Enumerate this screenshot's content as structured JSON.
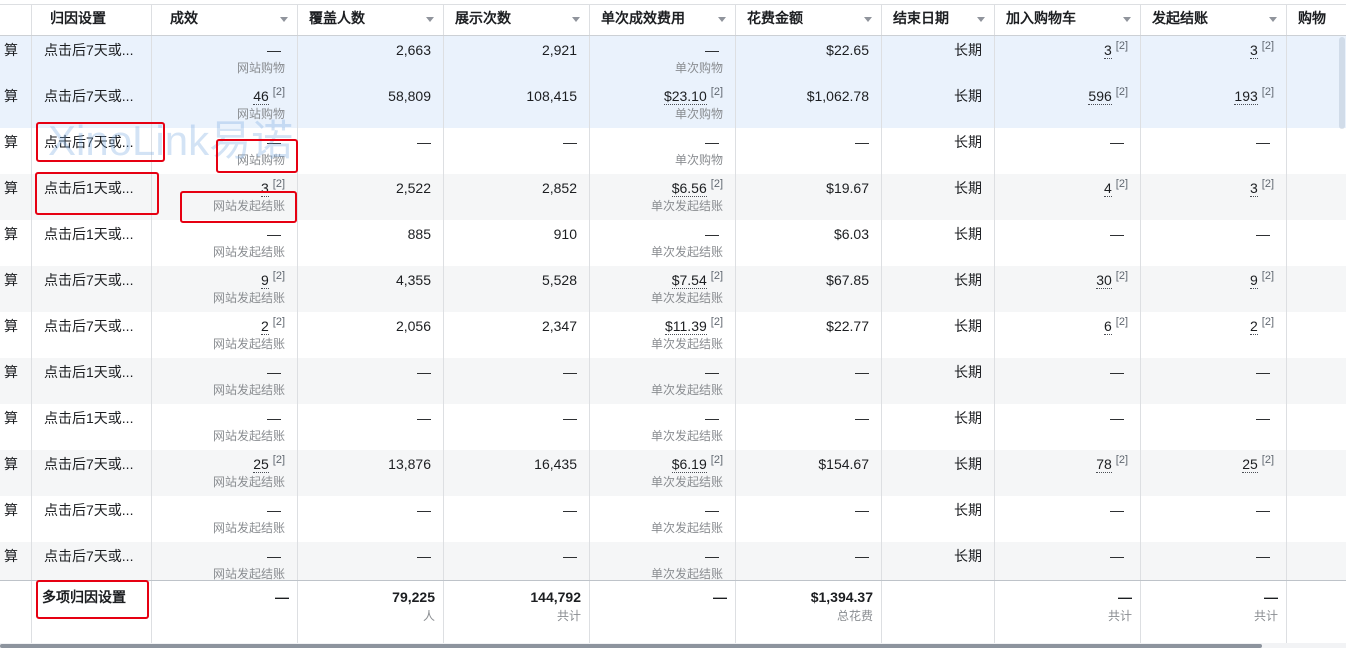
{
  "columns": {
    "attribution": "归因设置",
    "results": "成效",
    "reach": "覆盖人数",
    "impressions": "展示次数",
    "cost_per_result": "单次成效费用",
    "amount_spent": "花费金额",
    "end_date": "结束日期",
    "add_to_cart": "加入购物车",
    "checkouts": "发起结账",
    "purchases": "购物"
  },
  "icons": {
    "column_menu": "chevron-down-icon"
  },
  "colors": {
    "selected_row": "#eaf2fc",
    "striped_row": "#f5f6f7",
    "annotation": "#e60012"
  },
  "watermark": "XinoLink易诺",
  "rows": [
    {
      "highlighted": true,
      "lead": "算",
      "attribution": "点击后7天或...",
      "results": {
        "value": "—",
        "note": "",
        "sub": "网站购物"
      },
      "reach": "2,663",
      "impressions": "2,921",
      "cost_per_result": {
        "value": "—",
        "note": "",
        "sub": "单次购物"
      },
      "amount_spent": "$22.65",
      "end_date": "长期",
      "add_to_cart": {
        "value": "3",
        "note": "[2]"
      },
      "checkouts": {
        "value": "3",
        "note": "[2]"
      }
    },
    {
      "highlighted": true,
      "lead": "算",
      "attribution": "点击后7天或...",
      "results": {
        "value": "46",
        "note": "[2]",
        "sub": "网站购物"
      },
      "reach": "58,809",
      "impressions": "108,415",
      "cost_per_result": {
        "value": "$23.10",
        "note": "[2]",
        "sub": "单次购物"
      },
      "amount_spent": "$1,062.78",
      "end_date": "长期",
      "add_to_cart": {
        "value": "596",
        "note": "[2]"
      },
      "checkouts": {
        "value": "193",
        "note": "[2]"
      }
    },
    {
      "lead": "算",
      "attribution": "点击后7天或...",
      "results": {
        "value": "—",
        "note": "",
        "sub": "网站购物"
      },
      "reach": "—",
      "impressions": "—",
      "cost_per_result": {
        "value": "—",
        "note": "",
        "sub": "单次购物"
      },
      "amount_spent": "—",
      "end_date": "长期",
      "add_to_cart": {
        "value": "—",
        "note": ""
      },
      "checkouts": {
        "value": "—",
        "note": ""
      }
    },
    {
      "lead": "算",
      "attribution": "点击后1天或...",
      "results": {
        "value": "3",
        "note": "[2]",
        "sub": "网站发起结账"
      },
      "reach": "2,522",
      "impressions": "2,852",
      "cost_per_result": {
        "value": "$6.56",
        "note": "[2]",
        "sub": "单次发起结账"
      },
      "amount_spent": "$19.67",
      "end_date": "长期",
      "add_to_cart": {
        "value": "4",
        "note": "[2]"
      },
      "checkouts": {
        "value": "3",
        "note": "[2]"
      }
    },
    {
      "lead": "算",
      "attribution": "点击后1天或...",
      "results": {
        "value": "—",
        "note": "",
        "sub": "网站发起结账"
      },
      "reach": "885",
      "impressions": "910",
      "cost_per_result": {
        "value": "—",
        "note": "",
        "sub": "单次发起结账"
      },
      "amount_spent": "$6.03",
      "end_date": "长期",
      "add_to_cart": {
        "value": "—",
        "note": ""
      },
      "checkouts": {
        "value": "—",
        "note": ""
      }
    },
    {
      "lead": "算",
      "attribution": "点击后7天或...",
      "results": {
        "value": "9",
        "note": "[2]",
        "sub": "网站发起结账"
      },
      "reach": "4,355",
      "impressions": "5,528",
      "cost_per_result": {
        "value": "$7.54",
        "note": "[2]",
        "sub": "单次发起结账"
      },
      "amount_spent": "$67.85",
      "end_date": "长期",
      "add_to_cart": {
        "value": "30",
        "note": "[2]"
      },
      "checkouts": {
        "value": "9",
        "note": "[2]"
      }
    },
    {
      "lead": "算",
      "attribution": "点击后7天或...",
      "results": {
        "value": "2",
        "note": "[2]",
        "sub": "网站发起结账"
      },
      "reach": "2,056",
      "impressions": "2,347",
      "cost_per_result": {
        "value": "$11.39",
        "note": "[2]",
        "sub": "单次发起结账"
      },
      "amount_spent": "$22.77",
      "end_date": "长期",
      "add_to_cart": {
        "value": "6",
        "note": "[2]"
      },
      "checkouts": {
        "value": "2",
        "note": "[2]"
      }
    },
    {
      "lead": "算",
      "attribution": "点击后1天或...",
      "results": {
        "value": "—",
        "note": "",
        "sub": "网站发起结账"
      },
      "reach": "—",
      "impressions": "—",
      "cost_per_result": {
        "value": "—",
        "note": "",
        "sub": "单次发起结账"
      },
      "amount_spent": "—",
      "end_date": "长期",
      "add_to_cart": {
        "value": "—",
        "note": ""
      },
      "checkouts": {
        "value": "—",
        "note": ""
      }
    },
    {
      "lead": "算",
      "attribution": "点击后1天或...",
      "results": {
        "value": "—",
        "note": "",
        "sub": "网站发起结账"
      },
      "reach": "—",
      "impressions": "—",
      "cost_per_result": {
        "value": "—",
        "note": "",
        "sub": "单次发起结账"
      },
      "amount_spent": "—",
      "end_date": "长期",
      "add_to_cart": {
        "value": "—",
        "note": ""
      },
      "checkouts": {
        "value": "—",
        "note": ""
      }
    },
    {
      "lead": "算",
      "attribution": "点击后7天或...",
      "results": {
        "value": "25",
        "note": "[2]",
        "sub": "网站发起结账"
      },
      "reach": "13,876",
      "impressions": "16,435",
      "cost_per_result": {
        "value": "$6.19",
        "note": "[2]",
        "sub": "单次发起结账"
      },
      "amount_spent": "$154.67",
      "end_date": "长期",
      "add_to_cart": {
        "value": "78",
        "note": "[2]"
      },
      "checkouts": {
        "value": "25",
        "note": "[2]"
      }
    },
    {
      "lead": "算",
      "attribution": "点击后7天或...",
      "results": {
        "value": "—",
        "note": "",
        "sub": "网站发起结账"
      },
      "reach": "—",
      "impressions": "—",
      "cost_per_result": {
        "value": "—",
        "note": "",
        "sub": "单次发起结账"
      },
      "amount_spent": "—",
      "end_date": "长期",
      "add_to_cart": {
        "value": "—",
        "note": ""
      },
      "checkouts": {
        "value": "—",
        "note": ""
      }
    },
    {
      "lead": "算",
      "attribution": "点击后7天或...",
      "results": {
        "value": "—",
        "note": "",
        "sub": "网站发起结账"
      },
      "reach": "—",
      "impressions": "—",
      "cost_per_result": {
        "value": "—",
        "note": "",
        "sub": "单次发起结账"
      },
      "amount_spent": "—",
      "end_date": "长期",
      "add_to_cart": {
        "value": "—",
        "note": ""
      },
      "checkouts": {
        "value": "—",
        "note": ""
      }
    }
  ],
  "footer": {
    "attribution": "多项归因设置",
    "results": "—",
    "reach": {
      "value": "79,225",
      "sub": "人"
    },
    "impressions": {
      "value": "144,792",
      "sub": "共计"
    },
    "cost_per_result": "—",
    "amount_spent": {
      "value": "$1,394.37",
      "sub": "总花费"
    },
    "add_to_cart": {
      "value": "—",
      "sub": "共计"
    },
    "checkouts": {
      "value": "—",
      "sub": "共计"
    }
  }
}
